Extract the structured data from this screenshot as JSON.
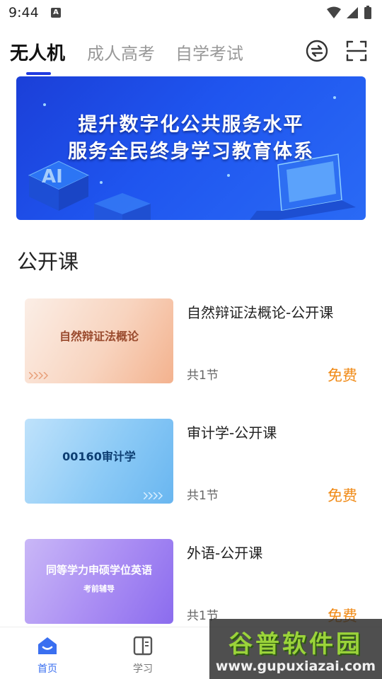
{
  "status_bar": {
    "time": "9:44",
    "notif_badge": "A"
  },
  "top_tabs": [
    {
      "label": "无人机",
      "active": true
    },
    {
      "label": "成人高考",
      "active": false
    },
    {
      "label": "自学考试",
      "active": false
    }
  ],
  "top_icons": [
    "switch-icon",
    "scan-icon"
  ],
  "banner": {
    "line1": "提升数字化公共服务水平",
    "line2": "服务全民终身学习教育体系",
    "ai_text": "AI"
  },
  "section": {
    "title": "公开课"
  },
  "courses": [
    {
      "thumb_text": "自然辩证法概论",
      "thumb_subtext": "",
      "title": "自然辩证法概论-公开课",
      "count": "共1节",
      "price": "免费"
    },
    {
      "thumb_text": "00160审计学",
      "thumb_subtext": "",
      "title": "审计学-公开课",
      "count": "共1节",
      "price": "免费"
    },
    {
      "thumb_text": "同等学力申硕学位英语",
      "thumb_subtext": "考前辅导",
      "title": "外语-公开课",
      "count": "共1节",
      "price": "免费"
    }
  ],
  "bottom_nav": [
    {
      "label": "首页",
      "icon": "home-icon",
      "active": true
    },
    {
      "label": "学习",
      "icon": "book-icon",
      "active": false
    }
  ],
  "colors": {
    "accent": "#1f3ae0",
    "price": "#f08a16",
    "nav_active": "#3a6ff0",
    "nav_inactive": "#777777"
  },
  "watermark": {
    "main": "谷普软件园",
    "url": "www.gupuxiazai.com"
  }
}
